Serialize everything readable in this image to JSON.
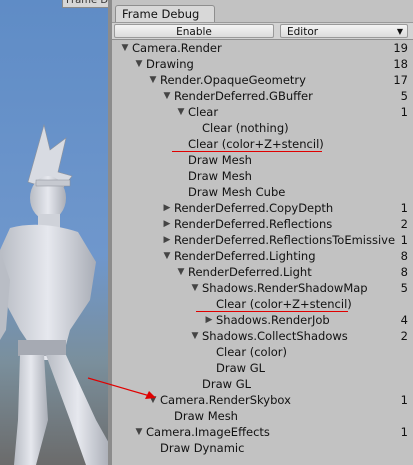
{
  "scene": {
    "window_title_stub": "Frame D"
  },
  "panel": {
    "tab_title": "Frame Debug",
    "enable_label": "Enable",
    "target_label": "Editor"
  },
  "tree": [
    {
      "label": "Camera.Render",
      "count": "19",
      "depth": 0,
      "state": "open"
    },
    {
      "label": "Drawing",
      "count": "18",
      "depth": 1,
      "state": "open"
    },
    {
      "label": "Render.OpaqueGeometry",
      "count": "17",
      "depth": 2,
      "state": "open"
    },
    {
      "label": "RenderDeferred.GBuffer",
      "count": "5",
      "depth": 3,
      "state": "open"
    },
    {
      "label": "Clear",
      "count": "1",
      "depth": 4,
      "state": "open"
    },
    {
      "label": "Clear (nothing)",
      "count": "",
      "depth": 5,
      "state": "leaf"
    },
    {
      "label": "Clear (color+Z+stencil)",
      "count": "",
      "depth": 4,
      "state": "leaf"
    },
    {
      "label": "Draw Mesh",
      "count": "",
      "depth": 4,
      "state": "leaf"
    },
    {
      "label": "Draw Mesh",
      "count": "",
      "depth": 4,
      "state": "leaf"
    },
    {
      "label": "Draw Mesh Cube",
      "count": "",
      "depth": 4,
      "state": "leaf"
    },
    {
      "label": "RenderDeferred.CopyDepth",
      "count": "1",
      "depth": 3,
      "state": "closed"
    },
    {
      "label": "RenderDeferred.Reflections",
      "count": "2",
      "depth": 3,
      "state": "closed"
    },
    {
      "label": "RenderDeferred.ReflectionsToEmissive",
      "count": "1",
      "depth": 3,
      "state": "closed"
    },
    {
      "label": "RenderDeferred.Lighting",
      "count": "8",
      "depth": 3,
      "state": "open"
    },
    {
      "label": "RenderDeferred.Light",
      "count": "8",
      "depth": 4,
      "state": "open"
    },
    {
      "label": "Shadows.RenderShadowMap",
      "count": "5",
      "depth": 5,
      "state": "open"
    },
    {
      "label": "Clear (color+Z+stencil)",
      "count": "",
      "depth": 6,
      "state": "leaf"
    },
    {
      "label": "Shadows.RenderJob",
      "count": "4",
      "depth": 6,
      "state": "closed"
    },
    {
      "label": "Shadows.CollectShadows",
      "count": "2",
      "depth": 5,
      "state": "open"
    },
    {
      "label": "Clear (color)",
      "count": "",
      "depth": 6,
      "state": "leaf"
    },
    {
      "label": "Draw GL",
      "count": "",
      "depth": 6,
      "state": "leaf"
    },
    {
      "label": "Draw GL",
      "count": "",
      "depth": 5,
      "state": "leaf"
    },
    {
      "label": "Camera.RenderSkybox",
      "count": "1",
      "depth": 2,
      "state": "open"
    },
    {
      "label": "Draw Mesh",
      "count": "",
      "depth": 3,
      "state": "leaf"
    },
    {
      "label": "Camera.ImageEffects",
      "count": "1",
      "depth": 1,
      "state": "open"
    },
    {
      "label": "Draw Dynamic",
      "count": "",
      "depth": 2,
      "state": "leaf"
    }
  ]
}
